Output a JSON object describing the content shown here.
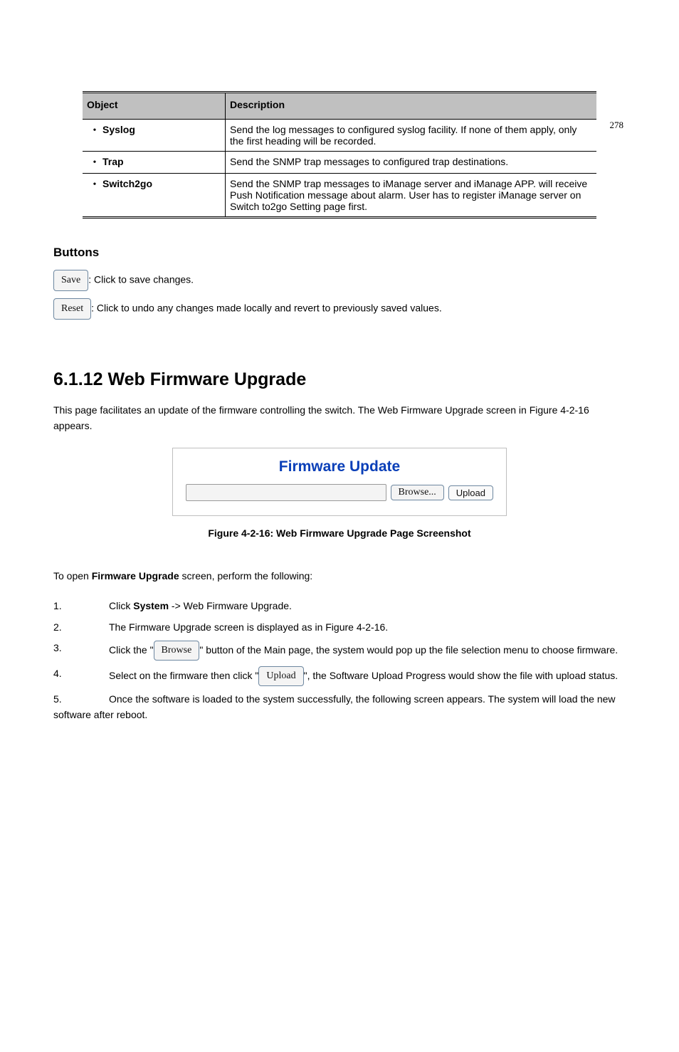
{
  "page_number": "278",
  "table": {
    "head_object": "Object",
    "head_desc": "Description",
    "rows": [
      {
        "item": "Syslog",
        "desc": "Send the log messages to configured syslog facility. If none of them apply, only the first heading will be recorded."
      },
      {
        "item": "Trap",
        "desc": "Send the SNMP trap messages to configured trap destinations."
      },
      {
        "item": "Switch2go",
        "desc": "Send the SNMP trap messages to iManage server and iManage APP. will receive Push Notification message about alarm. User has to register iManage server on Switch to2go Setting page first."
      }
    ]
  },
  "buttons_section": {
    "title": "Buttons",
    "save": {
      "label": "Save",
      "text": ": Click to save changes."
    },
    "reset": {
      "label": "Reset",
      "text": ": Click to undo any changes made locally and revert to previously saved values."
    }
  },
  "firmware": {
    "heading_number": "6.1.12",
    "heading_text": "Web Firmware Upgrade",
    "intro": "This page facilitates an update of the firmware controlling the switch. The Web Firmware Upgrade screen in Figure 4-2-16 appears.",
    "card_title": "Firmware Update",
    "browse_label": "Browse...",
    "upload_label": "Upload",
    "fig_caption": "Figure 4-2-16: Web Firmware Upgrade Page Screenshot",
    "procedure_intro": "To open Firmware Upgrade screen, perform the following:",
    "steps": [
      {
        "n": "1.",
        "prefix": "Click ",
        "bold": "System",
        "rest": " -> Web Firmware Upgrade."
      },
      {
        "n": "2.",
        "prefix": "The Firmware Upgrade screen is displayed as in Figure 4-2-16.",
        "bold": "",
        "rest": ""
      },
      {
        "n": "3.",
        "prefix": "Click the \"",
        "btn": "Browse",
        "rest": "\" button of the Main page, the system would pop up the file selection menu to choose firmware."
      },
      {
        "n": "4.",
        "prefix": "Select on the firmware then click \"",
        "btn": "Upload",
        "rest": "\", the Software Upload Progress would show the file with upload status."
      },
      {
        "n": "5.",
        "prefix": "Once the software is loaded to the system successfully, the following screen appears. The system will load the new software after reboot.",
        "bold": "",
        "rest": ""
      }
    ]
  }
}
